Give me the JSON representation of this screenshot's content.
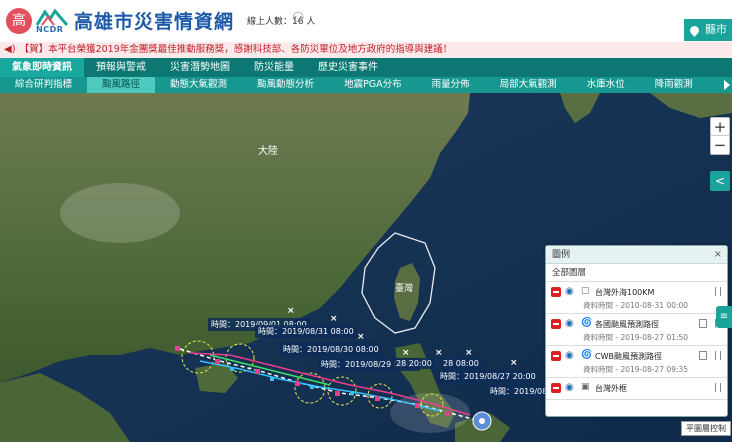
{
  "header": {
    "logo_glyph": "高",
    "ncdr_text": "NCDR",
    "title": "高雄市災害情資網",
    "online_label": "線上人數：16 人",
    "county_button": "縣市"
  },
  "marquee": {
    "text": "【賀】本平台榮獲2019年金團獎最佳推動服務獎，感謝科技部、各防災單位及地方政府的指導與建議！"
  },
  "nav_primary": [
    {
      "label": "氣象即時資訊",
      "active": true
    },
    {
      "label": "預報與警戒",
      "active": false
    },
    {
      "label": "災害潛勢地圖",
      "active": false
    },
    {
      "label": "防災能量",
      "active": false
    },
    {
      "label": "歷史災害事件",
      "active": false
    }
  ],
  "nav_secondary": [
    {
      "label": "綜合研判指標",
      "active": false
    },
    {
      "label": "颱風路徑",
      "active": true
    },
    {
      "label": "動態大氣觀測",
      "active": false
    },
    {
      "label": "颱風動態分析",
      "active": false
    },
    {
      "label": "地震PGA分布",
      "active": false
    },
    {
      "label": "雨量分佈",
      "active": false
    },
    {
      "label": "局部大氣觀測",
      "active": false
    },
    {
      "label": "水庫水位",
      "active": false
    },
    {
      "label": "降雨觀測",
      "active": false
    }
  ],
  "map": {
    "label_mainland": "大陸",
    "label_taiwan": "臺灣",
    "zoom_in": "+",
    "zoom_out": "−",
    "time_labels": [
      "時間：2019/09/01 08:00",
      "時間：2019/08/31 08:00",
      "時間：2019/08/30 08:00",
      "時間：2019/08/29 08:00",
      "28 20:00",
      "28 08:00",
      "時間：2019/08/27 20:00",
      "時間：2019/08"
    ]
  },
  "legend": {
    "title": "圖例",
    "close": "×",
    "all_layers": "全部圖層",
    "items": [
      {
        "name": "台灣外海100KM",
        "time": "資料時間 - 2010-08-31 00:00",
        "icon": "square-outline-icon"
      },
      {
        "name": "各國颱風預測路徑",
        "time": "資料時間 - 2019-08-27 01:50",
        "icon": "typhoon-icon"
      },
      {
        "name": "CWB颱風預測路徑",
        "time": "資料時間 - 2019-08-27 09:35",
        "icon": "typhoon-icon"
      },
      {
        "name": "台灣外框",
        "time": "",
        "icon": "image-icon"
      }
    ]
  },
  "layer_control": "平圖層控制",
  "colors": {
    "nav_dark": "#0d7873",
    "nav_light": "#16978f",
    "accent": "#1aa39a",
    "alert_text": "#c0202a",
    "title": "#1e5aa8"
  }
}
